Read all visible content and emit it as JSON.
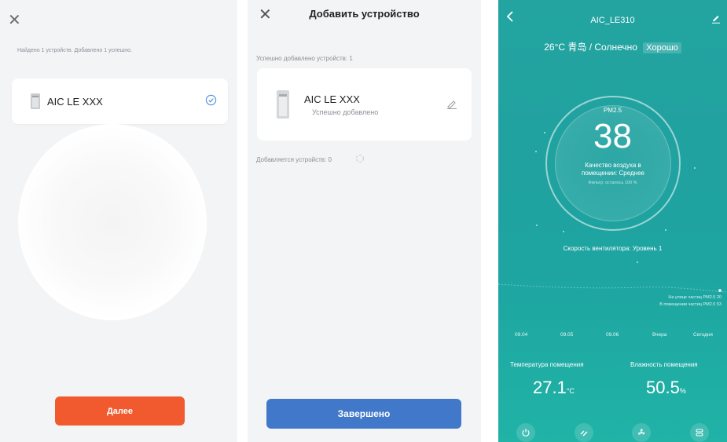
{
  "screen1": {
    "found_text": "Найдено 1 устройств. Добавлено 1 успешно.",
    "device_name": "AIC LE XXX",
    "next_label": "Далее",
    "accent": "#f05a2e"
  },
  "screen2": {
    "title": "Добавить устройство",
    "added_text": "Успешно добавлено устройств: 1",
    "device_name": "AIC LE XXX",
    "device_status": "Успешно добавлено",
    "adding_text": "Добавляется устройств: 0",
    "done_label": "Завершено",
    "accent": "#4178c9"
  },
  "screen3": {
    "device_title": "AIC_LE310",
    "weather": "26°C 青岛 / Солнечно",
    "air_outdoor": "Хорошо",
    "pm_label": "PM2.5",
    "pm_value": "38",
    "quality": "Качество воздуха в помещении: Среднее",
    "filter": "Фильтр: осталось 100 %",
    "fan_speed": "Скорость вентилятора: Уровень 1",
    "outdoor_pm": "На улице частиц PM2.5 20",
    "indoor_pm": "В помещении частиц PM2.5 53",
    "dates": [
      "09.04",
      "09.05",
      "09.06",
      "Вчера",
      "Сегодня"
    ],
    "temp_label": "Температура помещения",
    "temp_value": "27.1",
    "temp_unit": "°C",
    "hum_label": "Влажность помещения",
    "hum_value": "50.5",
    "hum_unit": "%",
    "controls": [
      "power-icon",
      "fan-mode-icon",
      "fan-speed-icon",
      "timer-icon"
    ],
    "accent": "#20a2a0"
  }
}
